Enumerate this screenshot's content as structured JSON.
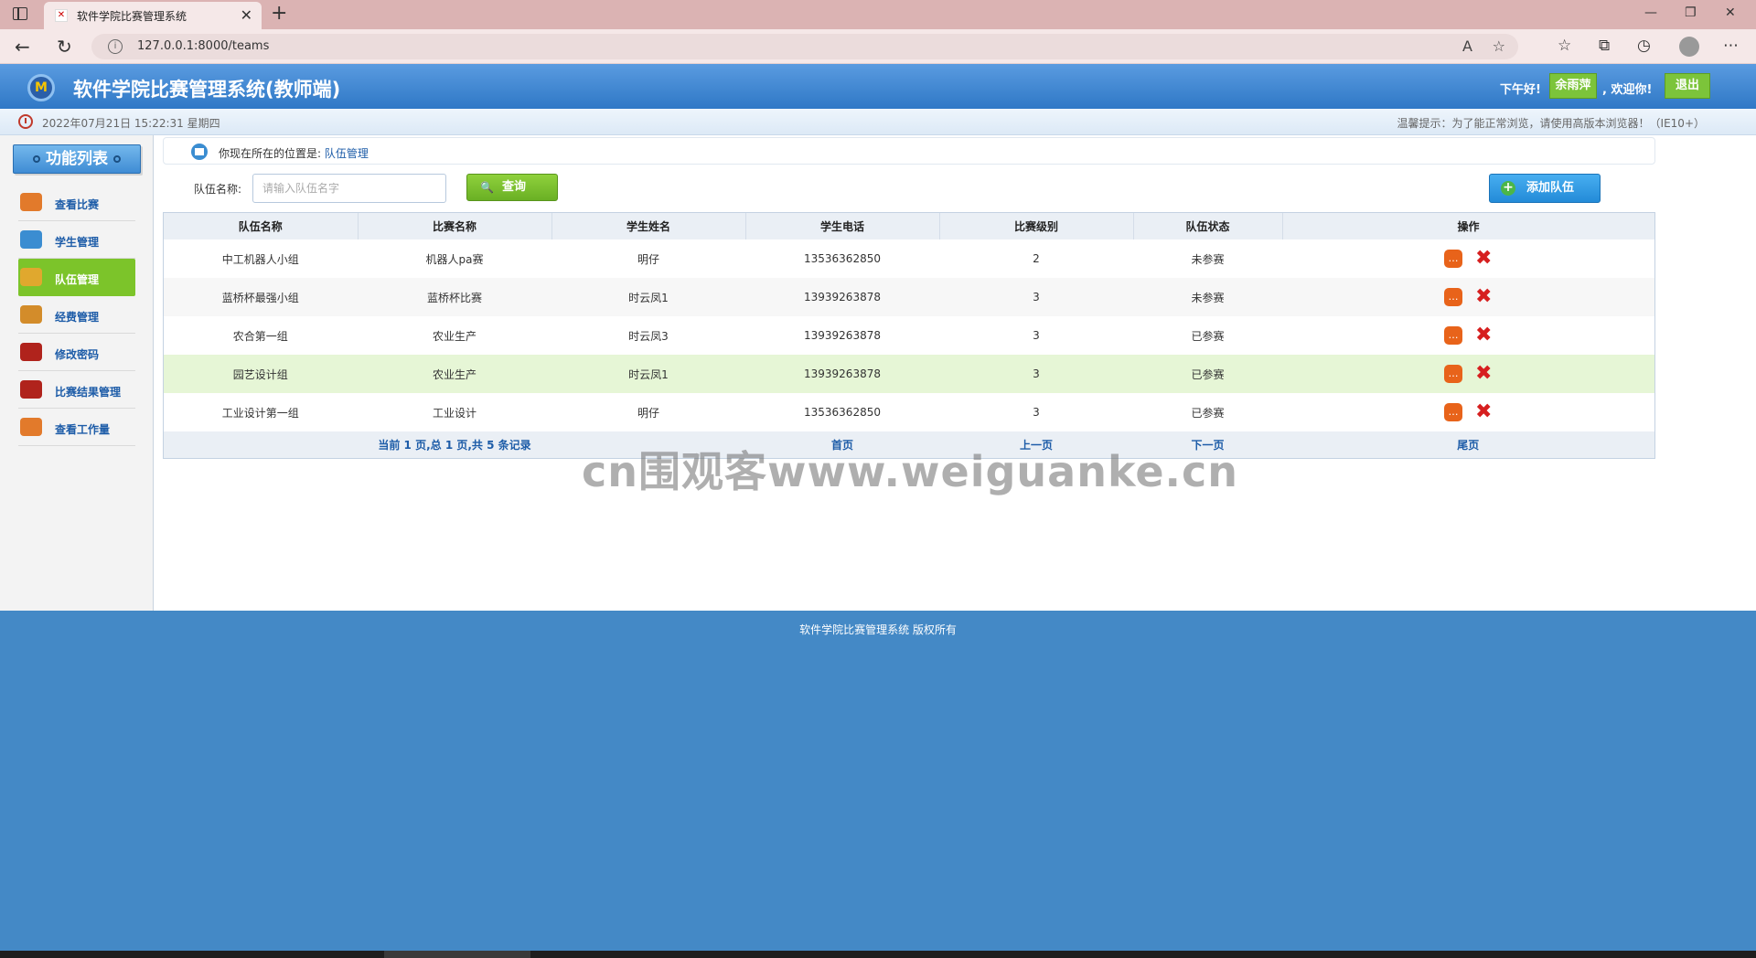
{
  "browser": {
    "tab_title": "软件学院比赛管理系统",
    "url": "127.0.0.1:8000/teams"
  },
  "header": {
    "title": "软件学院比赛管理系统(教师端)",
    "greeting": "下午好!",
    "user": "余雨萍",
    "welcome": ", 欢迎你!",
    "logout": "退出"
  },
  "status": {
    "datetime": "2022年07月21日 15:22:31 星期四",
    "tip": "温馨提示：为了能正常浏览，请使用高版本浏览器！（IE10+）"
  },
  "sidebar": {
    "title": "功能列表",
    "items": [
      {
        "label": "查看比赛",
        "icon": "pencil-book-icon",
        "color": "#e27a2b"
      },
      {
        "label": "学生管理",
        "icon": "chart-icon",
        "color": "#3b8dd1"
      },
      {
        "label": "队伍管理",
        "icon": "users-icon",
        "color": "#e0a82e",
        "active": true
      },
      {
        "label": "经费管理",
        "icon": "money-icon",
        "color": "#d38c2a"
      },
      {
        "label": "修改密码",
        "icon": "exit-icon",
        "color": "#b0231c"
      },
      {
        "label": "比赛结果管理",
        "icon": "exit-icon",
        "color": "#b0231c"
      },
      {
        "label": "查看工作量",
        "icon": "pencil-book-icon",
        "color": "#e27a2b"
      }
    ]
  },
  "breadcrumb": {
    "prefix": "你现在所在的位置是: ",
    "current": "队伍管理"
  },
  "search": {
    "label": "队伍名称:",
    "placeholder": "请输入队伍名字",
    "button": "查询"
  },
  "add_button": "添加队伍",
  "table": {
    "headers": [
      "队伍名称",
      "比赛名称",
      "学生姓名",
      "学生电话",
      "比赛级别",
      "队伍状态",
      "操作"
    ],
    "rows": [
      [
        "中工机器人小组",
        "机器人pa赛",
        "明仔",
        "13536362850",
        "2",
        "未参赛"
      ],
      [
        "蓝桥杯最强小组",
        "蓝桥杯比赛",
        "时云凤1",
        "13939263878",
        "3",
        "未参赛"
      ],
      [
        "农合第一组",
        "农业生产",
        "时云凤3",
        "13939263878",
        "3",
        "已参赛"
      ],
      [
        "园艺设计组",
        "农业生产",
        "时云凤1",
        "13939263878",
        "3",
        "已参赛"
      ],
      [
        "工业设计第一组",
        "工业设计",
        "明仔",
        "13536362850",
        "3",
        "已参赛"
      ]
    ]
  },
  "pager": {
    "summary": "当前 1 页,总 1 页,共 5 条记录",
    "first": "首页",
    "prev": "上一页",
    "next": "下一页",
    "last": "尾页"
  },
  "footer": "软件学院比赛管理系统 版权所有",
  "watermark": "cn围观客www.weiguanke.cn",
  "colors": {
    "header_blue": "#2f78c6",
    "accent_green": "#7cc42a",
    "link_blue": "#1d5ca8",
    "footer_blue": "#4489c6"
  }
}
